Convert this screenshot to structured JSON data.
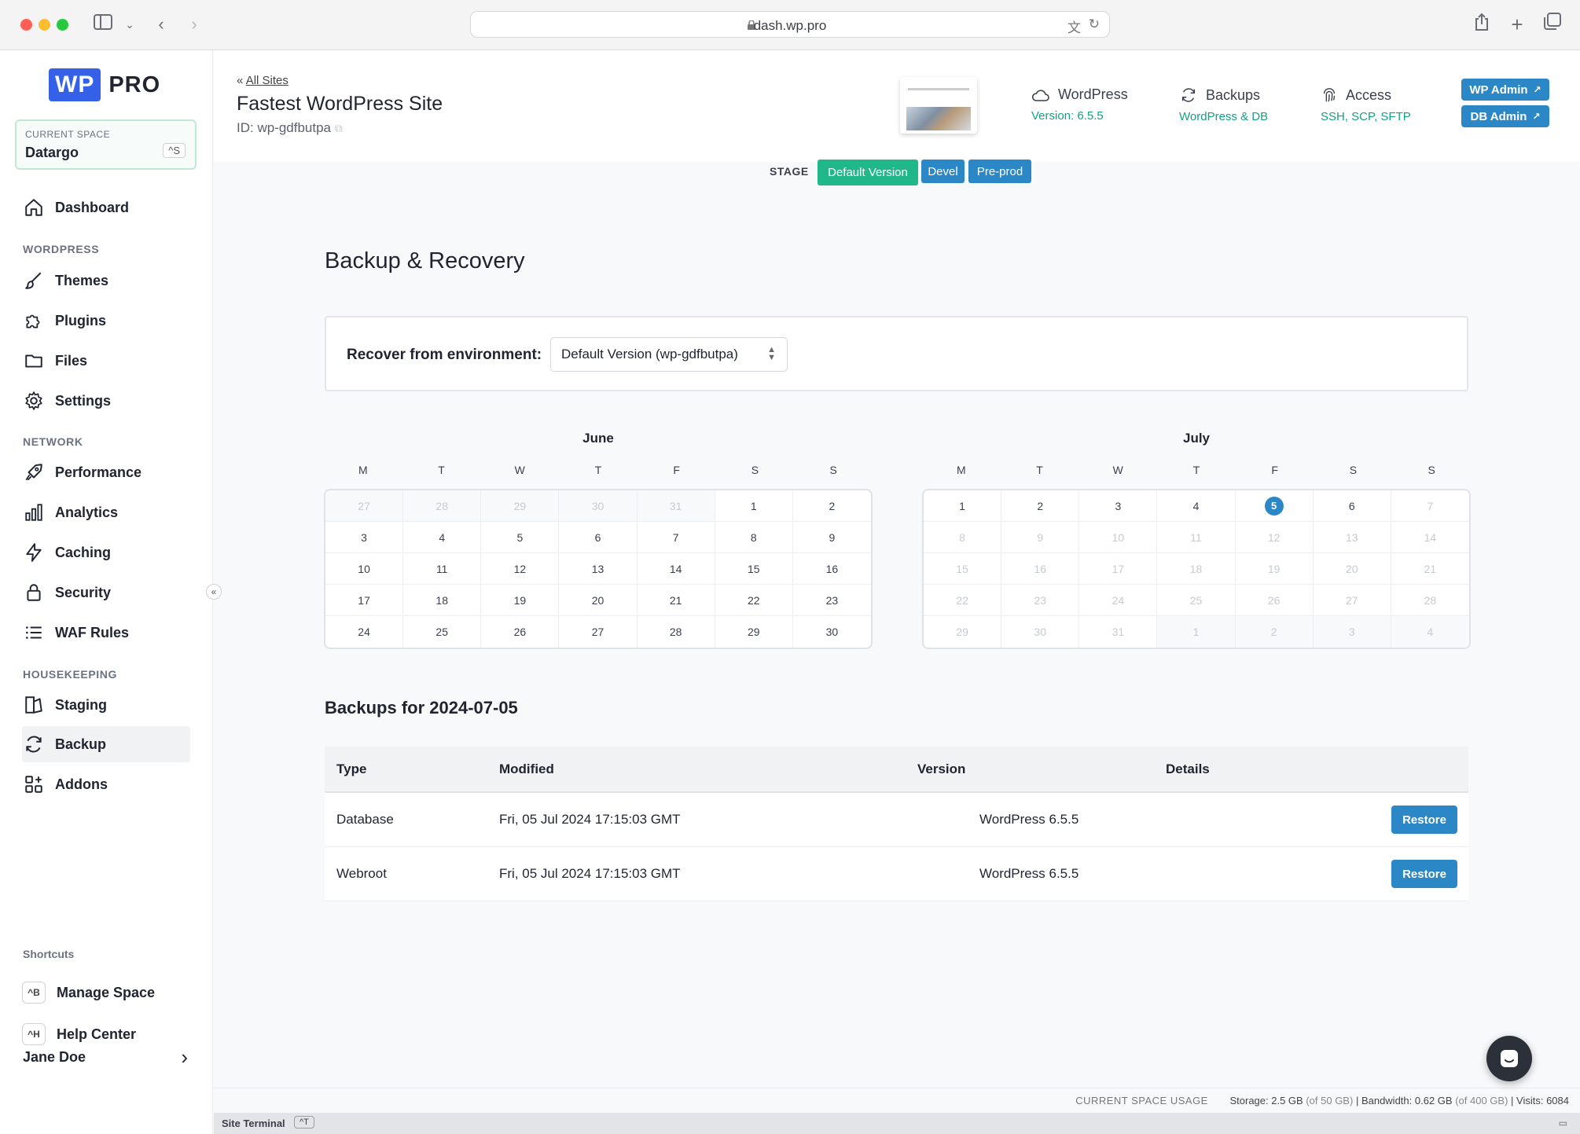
{
  "browser": {
    "url": "dash.wp.pro"
  },
  "logo": {
    "wp": "WP",
    "pro": "PRO"
  },
  "current_space": {
    "label": "CURRENT SPACE",
    "value": "Datargo",
    "shortcut": "^S"
  },
  "sidebar": {
    "dashboard": "Dashboard",
    "sections": {
      "wordpress": "WORDPRESS",
      "network": "NETWORK",
      "housekeeping": "HOUSEKEEPING"
    },
    "wordpress_items": [
      "Themes",
      "Plugins",
      "Files",
      "Settings"
    ],
    "network_items": [
      "Performance",
      "Analytics",
      "Caching",
      "Security",
      "WAF Rules"
    ],
    "housekeeping_items": [
      "Staging",
      "Backup",
      "Addons"
    ],
    "active_item": "Backup",
    "shortcuts_label": "Shortcuts",
    "shortcuts": [
      {
        "key": "^B",
        "label": "Manage Space"
      },
      {
        "key": "^H",
        "label": "Help Center"
      }
    ],
    "user": "Jane Doe"
  },
  "header": {
    "back_label": "All Sites",
    "site_title": "Fastest WordPress Site",
    "site_id": "ID: wp-gdfbutpa",
    "stats": [
      {
        "title": "WordPress",
        "sub": "Version: 6.5.5",
        "icon": "cloud-icon"
      },
      {
        "title": "Backups",
        "sub": "WordPress & DB",
        "icon": "sync-icon"
      },
      {
        "title": "Access",
        "sub": "SSH, SCP, SFTP",
        "icon": "fingerprint-icon"
      }
    ],
    "wp_admin": "WP Admin",
    "db_admin": "DB Admin"
  },
  "stage": {
    "label": "STAGE",
    "tabs": [
      "Default Version",
      "Devel",
      "Pre-prod"
    ],
    "active": "Default Version"
  },
  "main": {
    "heading": "Backup & Recovery",
    "recover_label": "Recover from environment:",
    "recover_value": "Default Version (wp-gdfbutpa)",
    "dow": [
      "M",
      "T",
      "W",
      "T",
      "F",
      "S",
      "S"
    ],
    "calendars": [
      {
        "month": "June",
        "days": [
          {
            "d": "27",
            "s": "muted"
          },
          {
            "d": "28",
            "s": "muted"
          },
          {
            "d": "29",
            "s": "muted"
          },
          {
            "d": "30",
            "s": "muted"
          },
          {
            "d": "31",
            "s": "muted"
          },
          {
            "d": "1",
            "s": ""
          },
          {
            "d": "2",
            "s": ""
          },
          {
            "d": "3",
            "s": ""
          },
          {
            "d": "4",
            "s": ""
          },
          {
            "d": "5",
            "s": ""
          },
          {
            "d": "6",
            "s": ""
          },
          {
            "d": "7",
            "s": ""
          },
          {
            "d": "8",
            "s": ""
          },
          {
            "d": "9",
            "s": ""
          },
          {
            "d": "10",
            "s": ""
          },
          {
            "d": "11",
            "s": ""
          },
          {
            "d": "12",
            "s": ""
          },
          {
            "d": "13",
            "s": ""
          },
          {
            "d": "14",
            "s": ""
          },
          {
            "d": "15",
            "s": ""
          },
          {
            "d": "16",
            "s": ""
          },
          {
            "d": "17",
            "s": ""
          },
          {
            "d": "18",
            "s": ""
          },
          {
            "d": "19",
            "s": ""
          },
          {
            "d": "20",
            "s": ""
          },
          {
            "d": "21",
            "s": ""
          },
          {
            "d": "22",
            "s": ""
          },
          {
            "d": "23",
            "s": ""
          },
          {
            "d": "24",
            "s": ""
          },
          {
            "d": "25",
            "s": ""
          },
          {
            "d": "26",
            "s": ""
          },
          {
            "d": "27",
            "s": ""
          },
          {
            "d": "28",
            "s": ""
          },
          {
            "d": "29",
            "s": ""
          },
          {
            "d": "30",
            "s": ""
          }
        ]
      },
      {
        "month": "July",
        "days": [
          {
            "d": "1",
            "s": ""
          },
          {
            "d": "2",
            "s": ""
          },
          {
            "d": "3",
            "s": ""
          },
          {
            "d": "4",
            "s": ""
          },
          {
            "d": "5",
            "s": "selected"
          },
          {
            "d": "6",
            "s": ""
          },
          {
            "d": "7",
            "s": "dim"
          },
          {
            "d": "8",
            "s": "dim"
          },
          {
            "d": "9",
            "s": "dim"
          },
          {
            "d": "10",
            "s": "dim"
          },
          {
            "d": "11",
            "s": "dim"
          },
          {
            "d": "12",
            "s": "dim"
          },
          {
            "d": "13",
            "s": "dim"
          },
          {
            "d": "14",
            "s": "dim"
          },
          {
            "d": "15",
            "s": "dim"
          },
          {
            "d": "16",
            "s": "dim"
          },
          {
            "d": "17",
            "s": "dim"
          },
          {
            "d": "18",
            "s": "dim"
          },
          {
            "d": "19",
            "s": "dim"
          },
          {
            "d": "20",
            "s": "dim"
          },
          {
            "d": "21",
            "s": "dim"
          },
          {
            "d": "22",
            "s": "dim"
          },
          {
            "d": "23",
            "s": "dim"
          },
          {
            "d": "24",
            "s": "dim"
          },
          {
            "d": "25",
            "s": "dim"
          },
          {
            "d": "26",
            "s": "dim"
          },
          {
            "d": "27",
            "s": "dim"
          },
          {
            "d": "28",
            "s": "dim"
          },
          {
            "d": "29",
            "s": "dim"
          },
          {
            "d": "30",
            "s": "dim"
          },
          {
            "d": "31",
            "s": "dim"
          },
          {
            "d": "1",
            "s": "muted"
          },
          {
            "d": "2",
            "s": "muted"
          },
          {
            "d": "3",
            "s": "muted"
          },
          {
            "d": "4",
            "s": "muted"
          }
        ]
      }
    ],
    "backups_heading": "Backups for 2024-07-05",
    "table_headers": [
      "Type",
      "Modified",
      "Version",
      "Details"
    ],
    "rows": [
      {
        "type": "Database",
        "modified": "Fri, 05 Jul 2024 17:15:03 GMT",
        "version": "WordPress 6.5.5",
        "action": "Restore"
      },
      {
        "type": "Webroot",
        "modified": "Fri, 05 Jul 2024 17:15:03 GMT",
        "version": "WordPress 6.5.5",
        "action": "Restore"
      }
    ]
  },
  "usage": {
    "label": "CURRENT SPACE USAGE",
    "storage": "Storage: 2.5 GB",
    "storage_of": "(of 50 GB)",
    "bandwidth": "Bandwidth: 0.62 GB",
    "bandwidth_of": "(of 400 GB)",
    "visits": "Visits: 6084"
  },
  "terminal": {
    "label": "Site Terminal",
    "key": "^T"
  },
  "colors": {
    "accent": "#2c87c6",
    "green": "#20b88a",
    "brand": "#3461e8"
  }
}
